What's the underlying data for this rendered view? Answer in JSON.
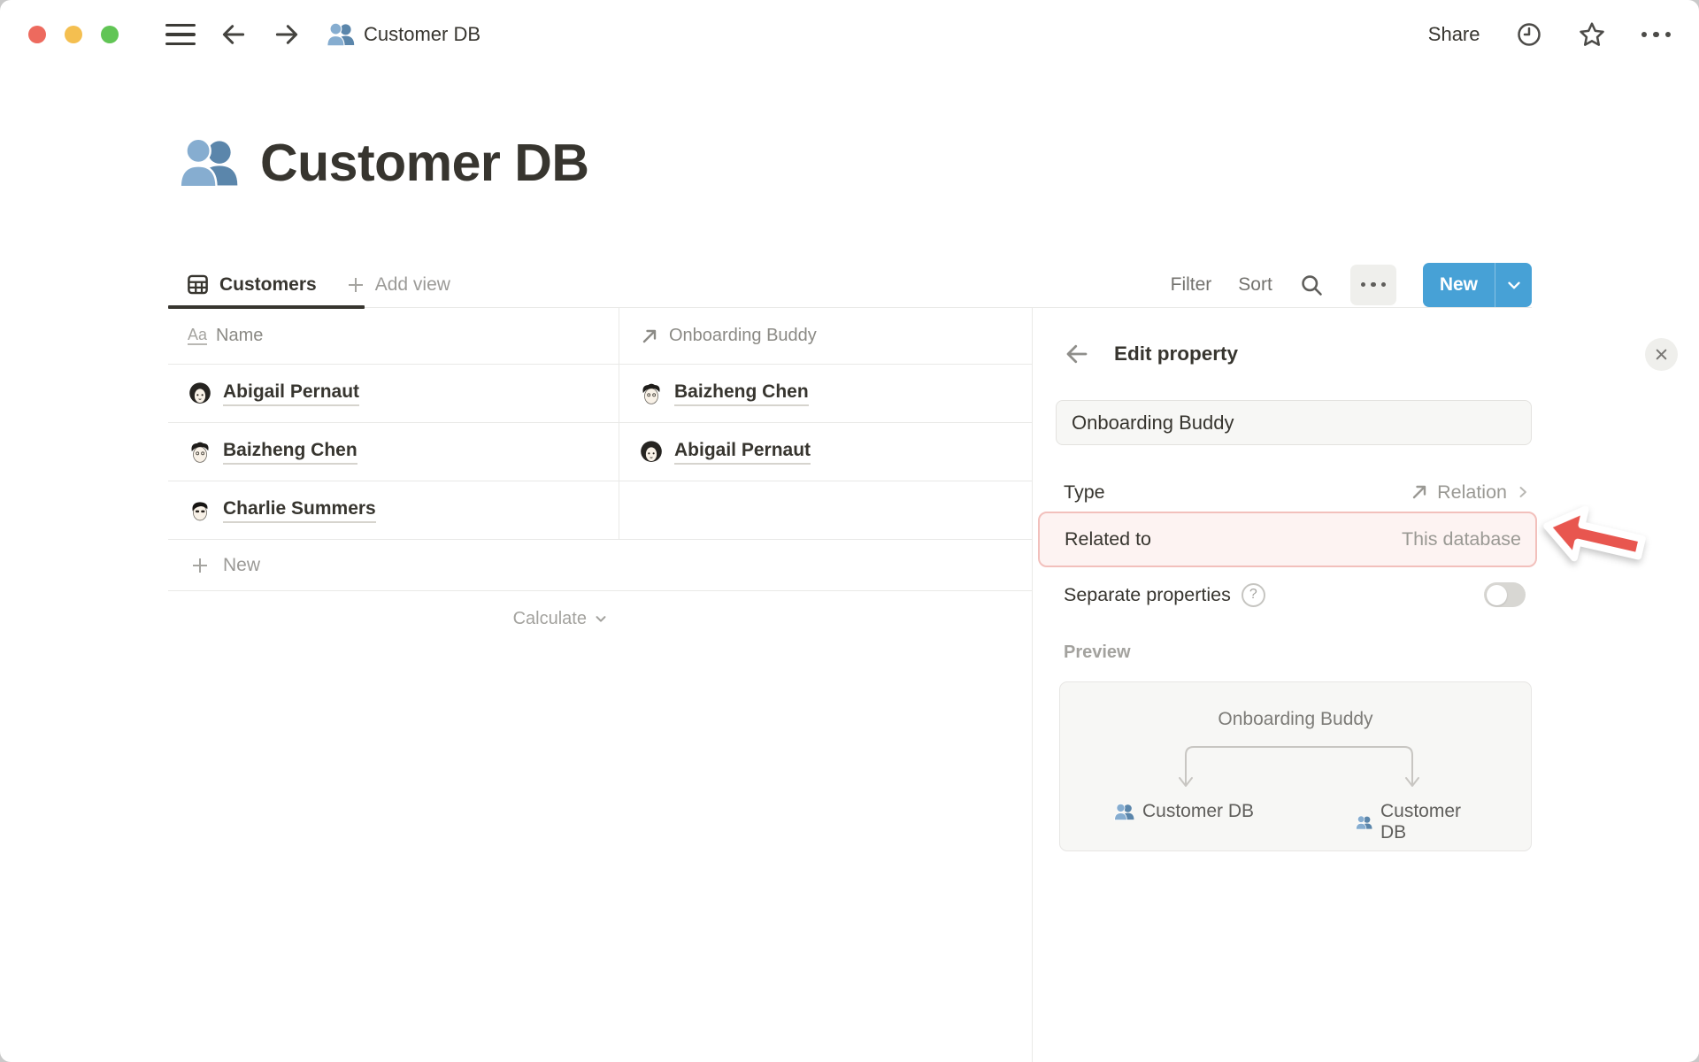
{
  "titlebar": {
    "doc_title": "Customer DB",
    "share_label": "Share"
  },
  "page": {
    "title": "Customer DB"
  },
  "view_bar": {
    "active_tab": "Customers",
    "add_view_label": "Add view",
    "filter_label": "Filter",
    "sort_label": "Sort",
    "new_button_label": "New"
  },
  "table": {
    "columns": [
      {
        "label": "Name"
      },
      {
        "label": "Onboarding Buddy"
      }
    ],
    "rows": [
      {
        "name": "Abigail Pernaut",
        "buddy": "Baizheng Chen"
      },
      {
        "name": "Baizheng Chen",
        "buddy": "Abigail Pernaut"
      },
      {
        "name": "Charlie Summers",
        "buddy": ""
      }
    ],
    "new_row_label": "New",
    "calculate_label": "Calculate"
  },
  "edit_panel": {
    "title": "Edit property",
    "name_input_value": "Onboarding Buddy",
    "type_label": "Type",
    "type_value": "Relation",
    "related_label": "Related to",
    "related_value": "This database",
    "separate_label": "Separate properties",
    "help_glyph": "?",
    "separate_toggle_on": false,
    "preview_label": "Preview",
    "preview": {
      "relation_name": "Onboarding Buddy",
      "left_db": "Customer DB",
      "right_db": "Customer DB"
    }
  },
  "icons": {
    "name_column_glyph": "Aa"
  },
  "colors": {
    "accent_blue": "#47a1d6",
    "highlight_bg": "#fdf3f2",
    "highlight_border": "#f2c0bc",
    "annotation_red": "#e8564f",
    "traffic_red": "#ed6a5e",
    "traffic_yellow": "#f4bf50",
    "traffic_green": "#61c555"
  }
}
